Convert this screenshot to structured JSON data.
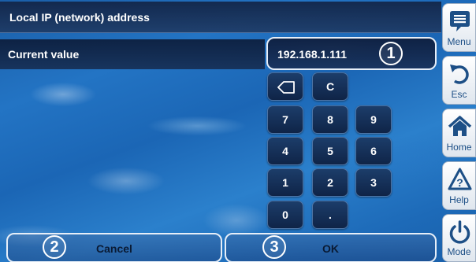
{
  "header": {
    "title": "Local IP (network) address"
  },
  "value_row": {
    "label": "Current value",
    "value": "192.168.1.111"
  },
  "markers": [
    "1",
    "2",
    "3"
  ],
  "keypad": {
    "keys": [
      "C",
      "7",
      "8",
      "9",
      "4",
      "5",
      "6",
      "1",
      "2",
      "3",
      "0",
      "."
    ],
    "backspace_icon": "backspace-arrow-icon"
  },
  "actions": {
    "cancel": "Cancel",
    "ok": "OK"
  },
  "sidebar": {
    "items": [
      {
        "label": "Menu",
        "icon": "menu-icon"
      },
      {
        "label": "Esc",
        "icon": "undo-arrow-icon"
      },
      {
        "label": "Home",
        "icon": "home-icon"
      },
      {
        "label": "Help",
        "icon": "help-warning-icon"
      },
      {
        "label": "Mode",
        "icon": "power-icon"
      }
    ]
  },
  "colors": {
    "accent": "#1d4f86",
    "panel": "#12244a",
    "water": "#2374c4"
  }
}
